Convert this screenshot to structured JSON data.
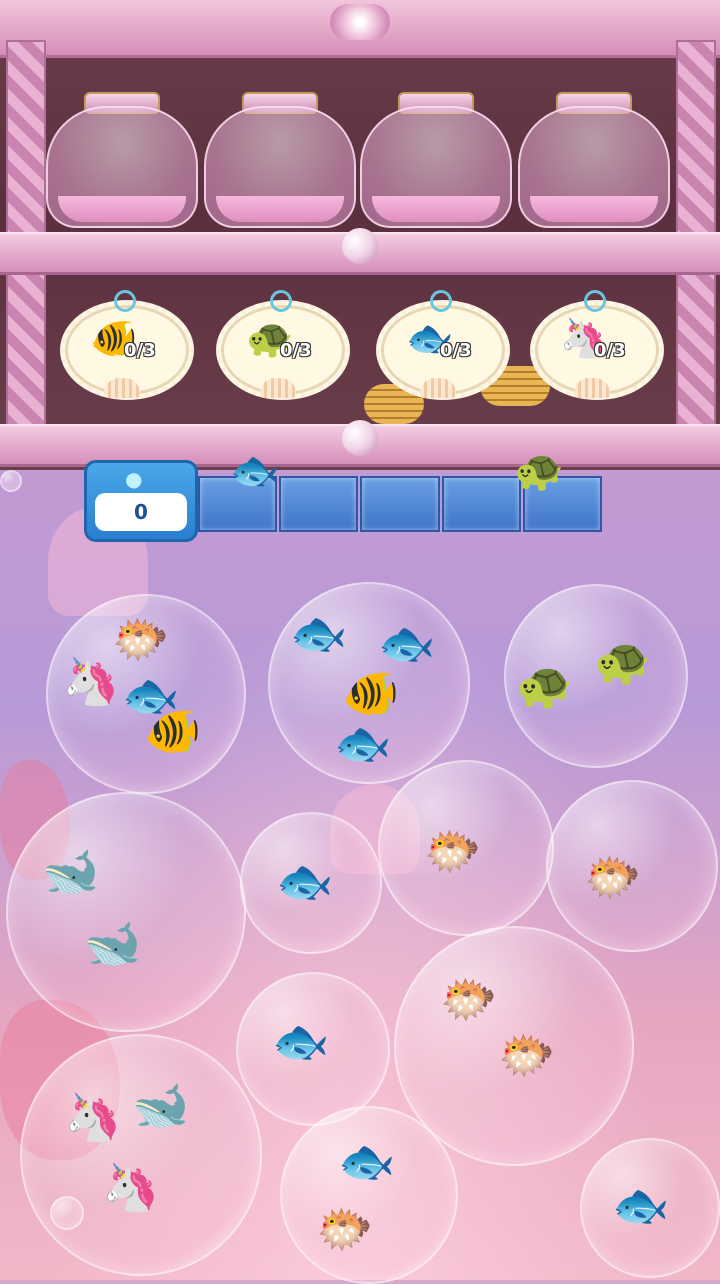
{
  "scoreboard": {
    "icon": "fish-icon",
    "value": "0"
  },
  "tray": {
    "slot_count": 5
  },
  "targets": [
    {
      "icon": "angelfish-icon",
      "emoji": "🐠",
      "count": "0/3"
    },
    {
      "icon": "turtle-icon",
      "emoji": "🐢",
      "count": "0/3"
    },
    {
      "icon": "clownfish-icon",
      "emoji": "🐟",
      "count": "0/3"
    },
    {
      "icon": "seahorse-icon",
      "emoji": "🦄",
      "count": "0/3"
    }
  ],
  "glyphs": {
    "yellowfish": "🐡",
    "seahorse": "🦄",
    "clownfish": "🐟",
    "angelfish": "🐠",
    "purplefish": "🐟",
    "bluetang": "🐟",
    "turtle": "🐢",
    "orca": "🐋",
    "puffer": "🐡"
  },
  "colors": {
    "slot": "#3f74c8",
    "score_frame": "#2a7fcf",
    "shelf": "#d48fb9"
  }
}
